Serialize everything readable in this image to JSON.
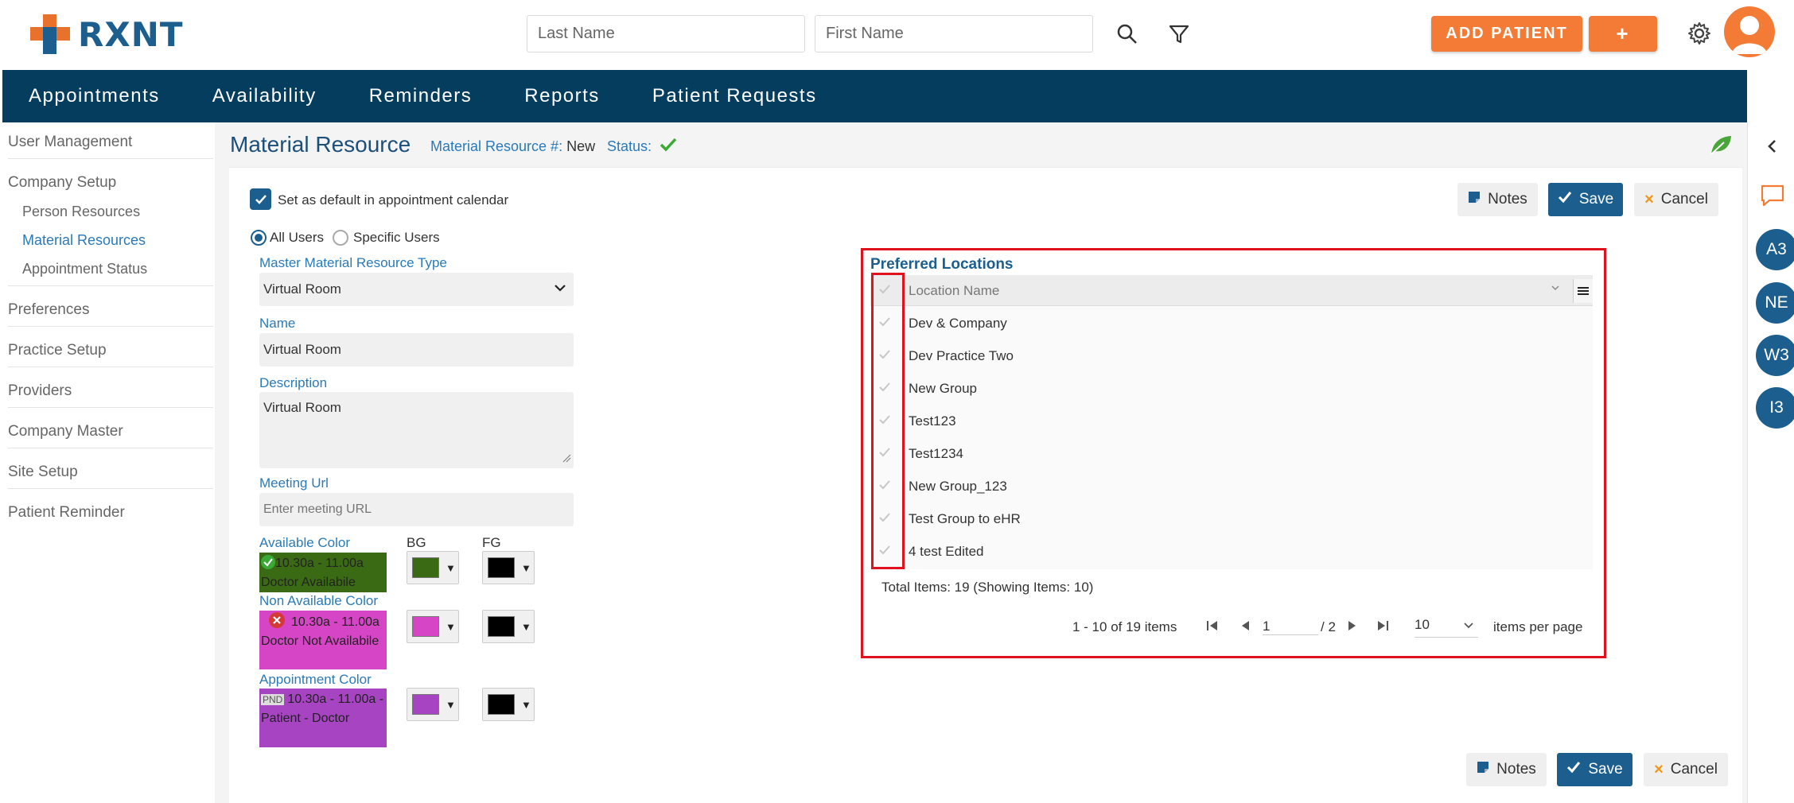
{
  "brand": {
    "name": "RXNT"
  },
  "header": {
    "last_name_placeholder": "Last Name",
    "first_name_placeholder": "First Name",
    "add_patient_label": "ADD PATIENT",
    "add_label": "+"
  },
  "nav": {
    "items": [
      "Appointments",
      "Availability",
      "Reminders",
      "Reports",
      "Patient Requests"
    ]
  },
  "sidebar": {
    "items": [
      "User Management",
      "Company Setup",
      "Person Resources",
      "Material Resources",
      "Appointment Status",
      "Preferences",
      "Practice Setup",
      "Providers",
      "Company Master",
      "Site Setup",
      "Patient Reminder"
    ]
  },
  "page": {
    "title": "Material Resource",
    "resource_num_label": "Material Resource #:",
    "resource_num_value": "New",
    "status_label": "Status:"
  },
  "form": {
    "default_checkbox_label": "Set as default in appointment calendar",
    "all_users_label": "All Users",
    "specific_users_label": "Specific Users",
    "type_label": "Master Material Resource Type",
    "type_value": "Virtual Room",
    "name_label": "Name",
    "name_value": "Virtual Room",
    "description_label": "Description",
    "description_value": "Virtual Room",
    "meeting_url_label": "Meeting Url",
    "meeting_url_placeholder": "Enter meeting URL",
    "available_color_label": "Available Color",
    "bg_label": "BG",
    "fg_label": "FG",
    "available_preview": "10.30a - 11.00a Doctor Availabile",
    "non_available_color_label": "Non Available Color",
    "non_available_preview": "10.30a - 11.00a Doctor Not Availabile",
    "appointment_color_label": "Appointment Color",
    "appointment_badge": "PND",
    "appointment_preview": "10.30a - 11.00a - Patient - Doctor",
    "colors": {
      "available_bg": "#3a6b14",
      "available_fg": "#000000",
      "non_available_bg": "#d645c6",
      "non_available_fg": "#000000",
      "appointment_bg": "#a644c2",
      "appointment_fg": "#000000"
    }
  },
  "buttons": {
    "notes": "Notes",
    "save": "Save",
    "cancel": "Cancel"
  },
  "preferred_locations": {
    "title": "Preferred Locations",
    "column_header": "Location Name",
    "rows": [
      "Dev & Company",
      "Dev Practice Two",
      "New Group",
      "Test123",
      "Test1234",
      "New Group_123",
      "Test Group to eHR",
      "4 test Edited"
    ],
    "total_items": "Total Items: 19 (Showing Items: 10)",
    "range_text": "1 - 10 of 19 items",
    "page_value": "1",
    "page_total": "/ 2",
    "page_size": "10",
    "per_page_label": "items per page"
  },
  "rail": {
    "badges": [
      "A3",
      "NE",
      "W3",
      "I3"
    ]
  },
  "theme": {
    "navy": "#053d5e",
    "brand_blue": "#1c5f8e",
    "orange": "#f47b35",
    "highlight_red": "#e0121e"
  }
}
